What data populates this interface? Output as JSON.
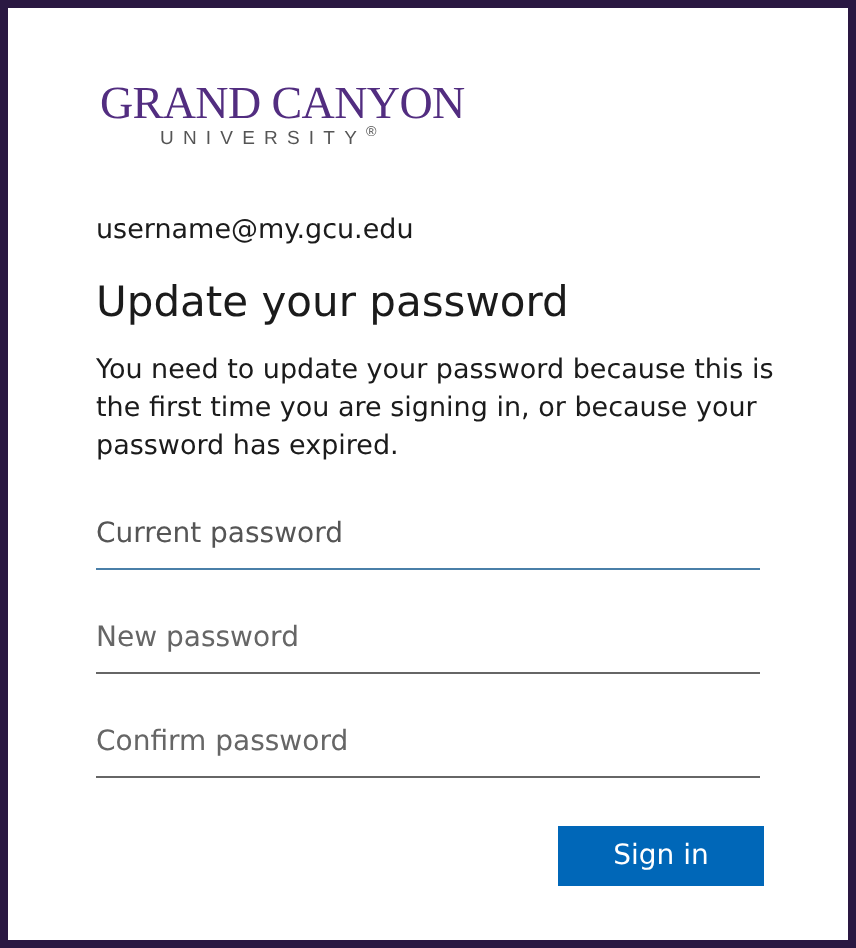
{
  "logo": {
    "name": "GRAND CANYON",
    "subtitle": "UNIVERSITY$^{®}$"
  },
  "account": "username@my.gcu.edu",
  "title": "Update your password",
  "message": "You need to update your password because this is the first time you are signing in, or because your password has expired.",
  "fields": [
    {
      "placeholder": "Current password",
      "focused": true
    },
    {
      "placeholder": "New password",
      "focused": false
    },
    {
      "placeholder": "Confirm password",
      "focused": false
    }
  ],
  "buttons": [
    "Sign in"
  ]
}
